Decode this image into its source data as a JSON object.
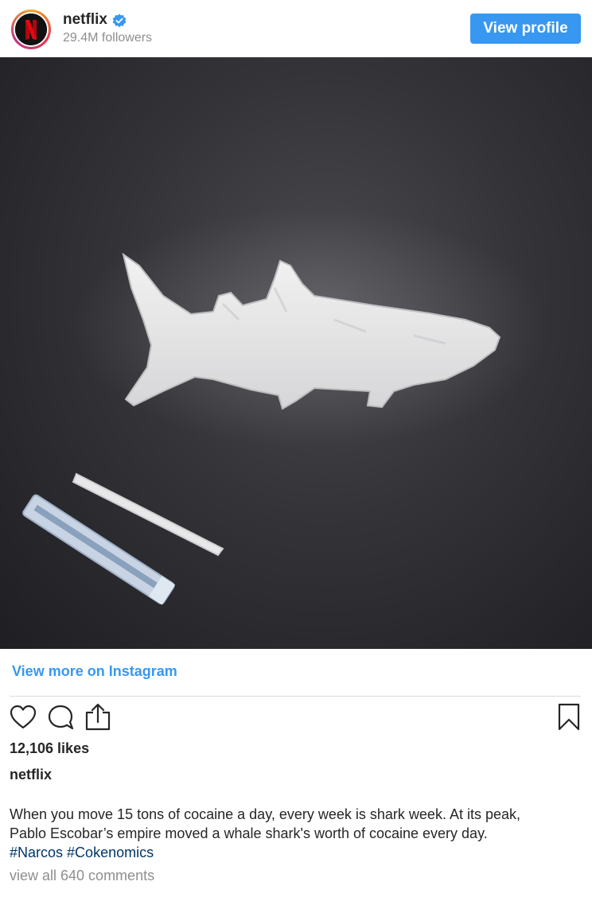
{
  "header": {
    "account_name": "netflix",
    "followers": "29.4M followers",
    "view_profile_label": "View profile",
    "avatar_letter": "N",
    "verified": true
  },
  "post": {
    "image_alt": "Shark shape made of white powder on dark slate with a rolled bill and a line of powder",
    "view_more_label": "View more on Instagram",
    "likes": "12,106 likes",
    "caption_user": "netflix",
    "caption_line1": "When you move 15 tons of cocaine a day, every week is shark week. At its peak,",
    "caption_line2": "Pablo Escobar’s empire moved a whale shark's worth of cocaine every day.",
    "hashtags": [
      "#Narcos",
      "#Cokenomics"
    ],
    "comments_link": "view all 640 comments"
  },
  "actions": {
    "like_icon": "heart-icon",
    "comment_icon": "comment-icon",
    "share_icon": "share-icon",
    "save_icon": "bookmark-icon"
  },
  "colors": {
    "accent_blue": "#3897f0",
    "hashtag_blue": "#003569",
    "muted_gray": "#8e8e8e",
    "netflix_red": "#e50914"
  }
}
